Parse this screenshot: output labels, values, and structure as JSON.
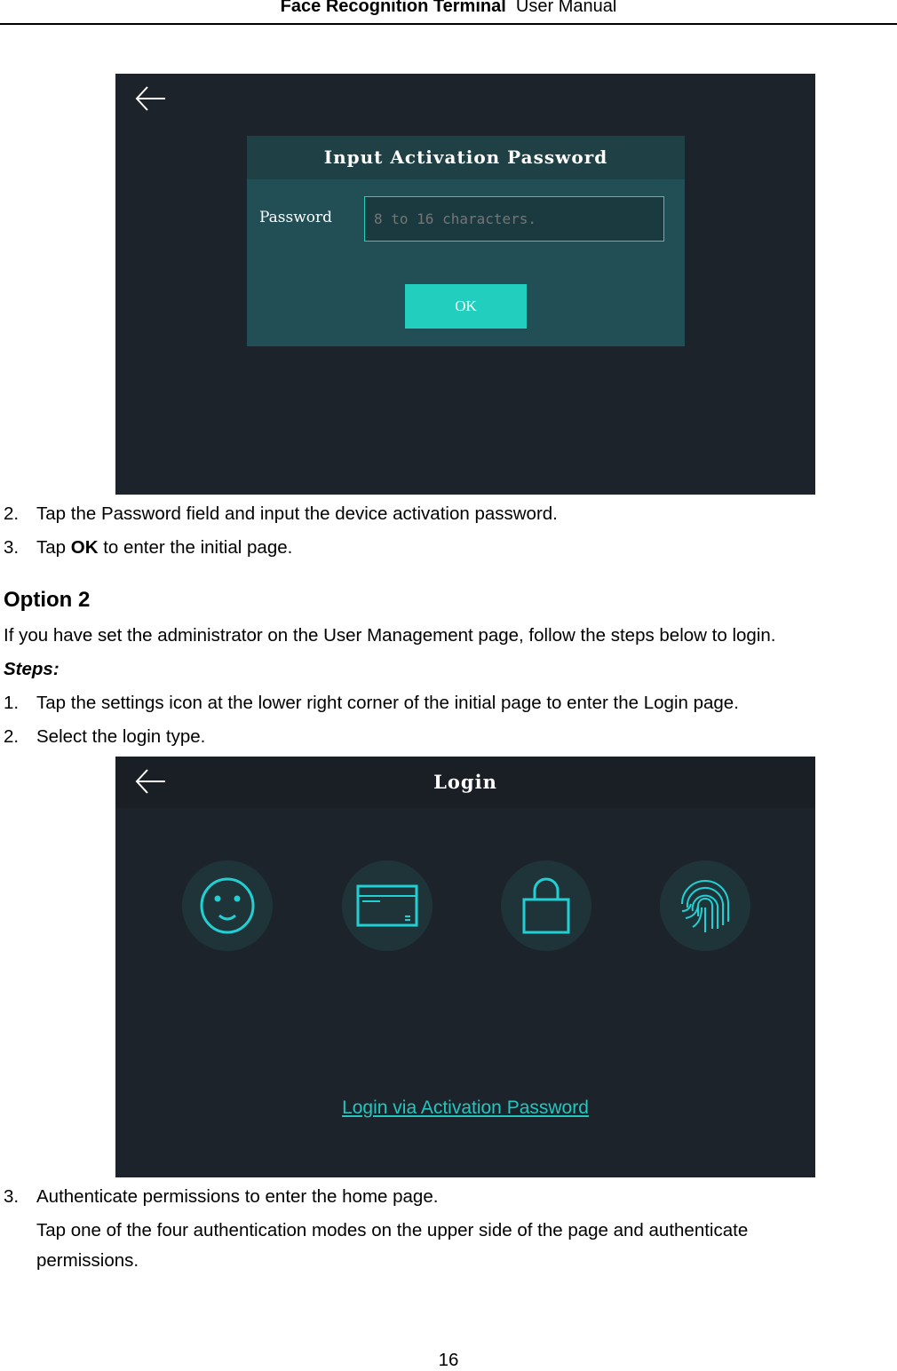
{
  "header": {
    "product": "Face Recognition Terminal",
    "doc": "User Manual"
  },
  "screen1": {
    "title": "Input Activation Password",
    "password_label": "Password",
    "password_placeholder": "8 to 16 characters.",
    "password_value": "",
    "ok_label": "OK",
    "back_icon": "arrow-left-icon"
  },
  "steps_a": [
    {
      "num": "2.",
      "text": "Tap the Password field and input the device activation password."
    },
    {
      "num": "3.",
      "pre": "Tap ",
      "bold": "OK",
      "post": " to enter the initial page."
    }
  ],
  "option2": {
    "heading": "Option 2",
    "intro": "If you have set the administrator on the User Management page, follow the steps below to login.",
    "steps_label": "Steps:"
  },
  "steps_b": [
    {
      "num": "1.",
      "text": "Tap the settings icon at the lower right corner of the initial page to enter the Login page."
    },
    {
      "num": "2.",
      "text": "Select the login type."
    }
  ],
  "screen2": {
    "title": "Login",
    "modes": [
      "face-icon",
      "card-icon",
      "lock-icon",
      "fingerprint-icon"
    ],
    "link": "Login via Activation Password",
    "accent": "#22cfbf"
  },
  "steps_c": [
    {
      "num": "3.",
      "text": "Authenticate permissions to enter the home page.",
      "detail1": "Tap one of the four authentication modes on the upper side of the page and authenticate",
      "detail2": "permissions."
    }
  ],
  "page_number": "16"
}
